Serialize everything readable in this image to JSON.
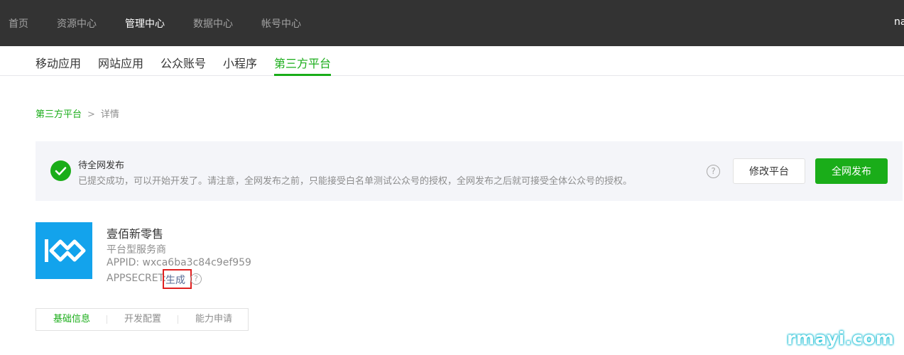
{
  "topnav": {
    "items": [
      {
        "label": "首页"
      },
      {
        "label": "资源中心"
      },
      {
        "label": "管理中心"
      },
      {
        "label": "数据中心"
      },
      {
        "label": "帐号中心"
      }
    ],
    "active": "管理中心",
    "user_label": "na"
  },
  "subnav": {
    "items": [
      {
        "label": "移动应用"
      },
      {
        "label": "网站应用"
      },
      {
        "label": "公众账号"
      },
      {
        "label": "小程序"
      },
      {
        "label": "第三方平台"
      }
    ],
    "active": "第三方平台"
  },
  "breadcrumb": {
    "parent": "第三方平台",
    "separator": ">",
    "current": "详情"
  },
  "status": {
    "title": "待全网发布",
    "description": "已提交成功，可以开始开发了。请注意，全网发布之前，只能接受白名单测试公众号的授权，全网发布之后就可接受全体公众号的授权。",
    "help_glyph": "?",
    "modify_button": "修改平台",
    "publish_button": "全网发布"
  },
  "app": {
    "name": "壹佰新零售",
    "type": "平台型服务商",
    "appid_text": "APPID: wxca6ba3c84c9ef959",
    "appsecret_label": "APPSECRET:",
    "generate_link": "生成",
    "help_glyph": "?",
    "logo_icon": "infinity-logo-icon"
  },
  "tabs": [
    {
      "label": "基础信息"
    },
    {
      "label": "开发配置"
    },
    {
      "label": "能力申请"
    }
  ],
  "active_tab": "基础信息",
  "watermark": "rmayi.com",
  "colors": {
    "brand_green": "#1aad19",
    "topbar_bg": "#333333",
    "logo_bg": "#13a3ec",
    "highlight_red": "#e02020"
  }
}
